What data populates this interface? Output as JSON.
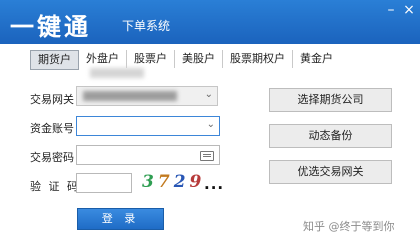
{
  "window": {
    "title_main": "一键通",
    "title_sub": "下单系统",
    "minimize_glyph": "–",
    "close_glyph": "×"
  },
  "tabs": [
    {
      "label": "期货户",
      "active": true
    },
    {
      "label": "外盘户",
      "active": false
    },
    {
      "label": "股票户",
      "active": false
    },
    {
      "label": "美股户",
      "active": false
    },
    {
      "label": "股票期权户",
      "active": false
    },
    {
      "label": "黄金户",
      "active": false
    }
  ],
  "form": {
    "gateway_label": "交易网关",
    "account_label": "资金账号",
    "password_label": "交易密码",
    "captcha_label": "验 证 码",
    "captcha_digits": [
      "3",
      "7",
      "2",
      "9"
    ],
    "captcha_refresh": "...",
    "login_button": "登 录",
    "dropdown_glyph": "⌄"
  },
  "side_buttons": [
    "选择期货公司",
    "动态备份",
    "优选交易网关"
  ],
  "watermark": "知乎 @终于等到你",
  "colors": {
    "title_bar": "#1b63bd",
    "accent": "#3d86d8",
    "login_button": "#1f6cc6"
  }
}
